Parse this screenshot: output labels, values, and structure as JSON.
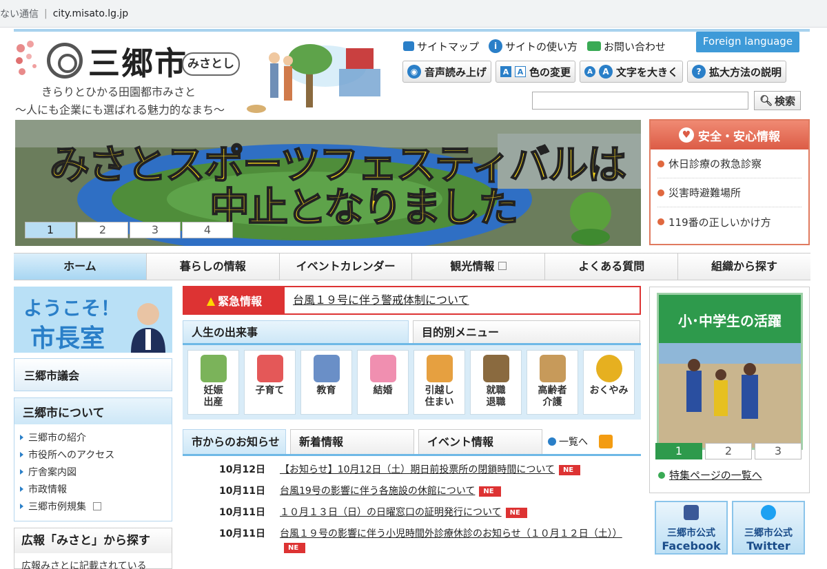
{
  "browser": {
    "security_text": "ない通信",
    "url": "city.misato.lg.jp"
  },
  "logo": {
    "city_name": "三郷市",
    "kana": "みさとし"
  },
  "tagline": {
    "line1": "きらりとひかる田園都市みさと",
    "line2": "～人にも企業にも選ばれる魅力的なまち～"
  },
  "top_links": {
    "sitemap": "サイトマップ",
    "howto": "サイトの使い方",
    "contact": "お問い合わせ",
    "foreign": "Foreign language"
  },
  "tools": {
    "voice": "音声読み上げ",
    "color": "色の変更",
    "font": "文字を大きく",
    "zoom": "拡大方法の説明"
  },
  "search": {
    "button": "検索",
    "placeholder": ""
  },
  "banner": {
    "line1": "みさとスポーツフェスティバルは",
    "line2": "中止となりました",
    "pages": [
      "1",
      "2",
      "3",
      "4"
    ]
  },
  "safety": {
    "title": "安全・安心情報",
    "items": [
      "休日診療の救急診察",
      "災害時避難場所",
      "119番の正しいかけ方"
    ]
  },
  "gnav": [
    "ホーム",
    "暮らしの情報",
    "イベントカレンダー",
    "観光情報",
    "よくある質問",
    "組織から探す"
  ],
  "mayor": {
    "line1": "ようこそ！",
    "line2": "市長室"
  },
  "council": "三郷市議会",
  "about": {
    "title": "三郷市について",
    "items": [
      "三郷市の紹介",
      "市役所へのアクセス",
      "庁舎案内図",
      "市政情報",
      "三郷市例規集"
    ]
  },
  "koho": {
    "title": "広報「みさと」から探す",
    "desc": "広報みさとに記載されている"
  },
  "emergency": {
    "tag": "緊急情報",
    "message": "台風１９号に伴う警戒体制について"
  },
  "life_tabs": {
    "events": "人生の出来事",
    "menu": "目的別メニュー"
  },
  "life_items": [
    {
      "label1": "妊娠",
      "label2": "出産",
      "color": "#7bb35a"
    },
    {
      "label1": "子育て",
      "label2": "",
      "color": "#e45858"
    },
    {
      "label1": "教育",
      "label2": "",
      "color": "#6a8fc7"
    },
    {
      "label1": "結婚",
      "label2": "",
      "color": "#f08fb0"
    },
    {
      "label1": "引越し",
      "label2": "住まい",
      "color": "#e6a040"
    },
    {
      "label1": "就職",
      "label2": "退職",
      "color": "#8a6a3f"
    },
    {
      "label1": "高齢者",
      "label2": "介護",
      "color": "#c79a5a"
    },
    {
      "label1": "おくやみ",
      "label2": "",
      "color": "#e6b020"
    }
  ],
  "news_tabs": {
    "city": "市からのお知らせ",
    "new": "新着情報",
    "event": "イベント情報",
    "more": "一覧へ"
  },
  "news": [
    {
      "date": "10月12日",
      "title": "【お知らせ】10月12日（土）期日前投票所の閉鎖時間について",
      "badge": "NE"
    },
    {
      "date": "10月11日",
      "title": "台風19号の影響に伴う各施設の休館について",
      "badge": "NE"
    },
    {
      "date": "10月11日",
      "title": "１０月１３日（日）の日曜窓口の証明発行について",
      "badge": "NE"
    },
    {
      "date": "10月11日",
      "title": "台風１９号の影響に伴う小児時間外診療休診のお知らせ（１０月１２日（土））",
      "badge": "NE"
    }
  ],
  "feature": {
    "caption": "小･中学生の活躍",
    "pages": [
      "1",
      "2",
      "3"
    ],
    "link": "特集ページの一覧へ"
  },
  "sns": {
    "facebook": {
      "line1": "三郷市公式",
      "line2": "Facebook"
    },
    "twitter": {
      "line1": "三郷市公式",
      "line2": "Twitter"
    }
  }
}
